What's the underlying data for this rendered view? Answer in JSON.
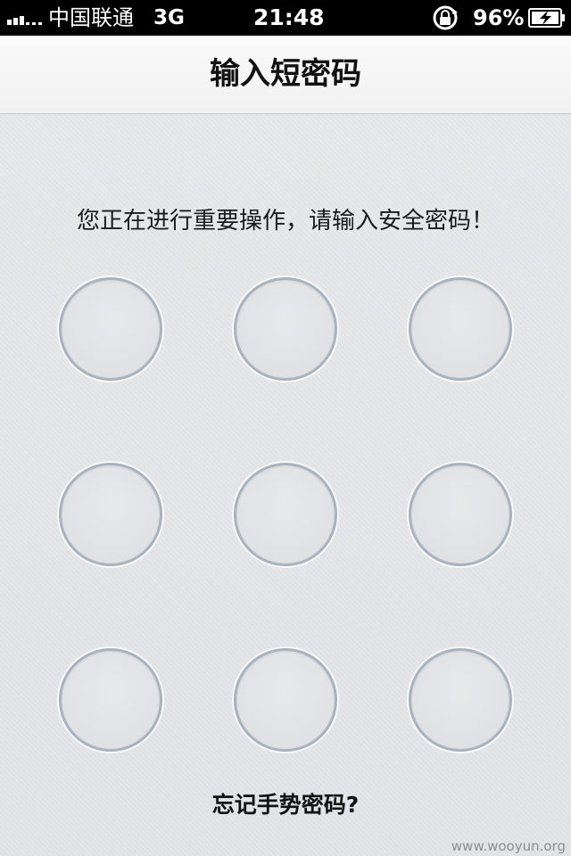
{
  "status_bar": {
    "carrier": "中国联通",
    "network": "3G",
    "time": "21:48",
    "battery_percent": "96%"
  },
  "nav": {
    "title": "输入短密码"
  },
  "prompt": "您正在进行重要操作，请输入安全密码！",
  "gesture_points": [
    1,
    2,
    3,
    4,
    5,
    6,
    7,
    8,
    9
  ],
  "forgot_label": "忘记手势密码?",
  "watermark": "www.wooyun.org",
  "colors": {
    "dot_border": "#a9b3be",
    "background": "#e3e5e8",
    "nav_background": "#f5f5f5"
  }
}
